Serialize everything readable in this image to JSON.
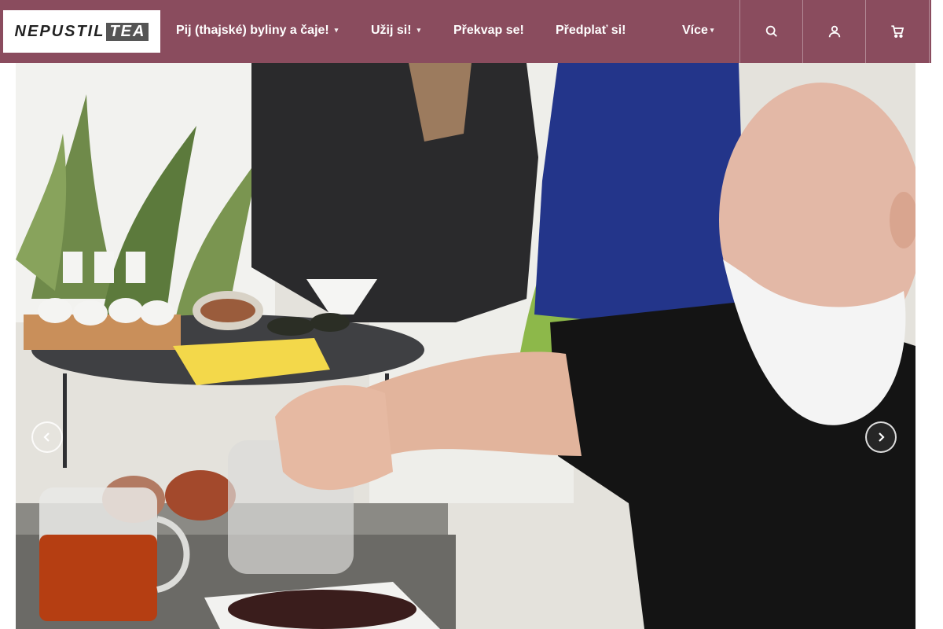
{
  "brand": {
    "logo_text": "NEPUSTIL",
    "logo_suffix": "TEA"
  },
  "nav": {
    "items": [
      {
        "label": "Pij (thajské) byliny a čaje!",
        "has_dropdown": true
      },
      {
        "label": "Užij si!",
        "has_dropdown": true
      },
      {
        "label": "Překvap se!",
        "has_dropdown": false
      },
      {
        "label": "Předplať si!",
        "has_dropdown": false
      },
      {
        "label": "Více",
        "has_dropdown": true
      }
    ],
    "icons": [
      "search-icon",
      "user-icon",
      "cart-icon"
    ]
  },
  "hero": {
    "image_alt": "Tea tasting photo",
    "prev_icon": "chevron-left-icon",
    "next_icon": "chevron-right-icon"
  },
  "colors": {
    "header_bg": "#8a4c5e",
    "nav_text": "#ffffff"
  }
}
